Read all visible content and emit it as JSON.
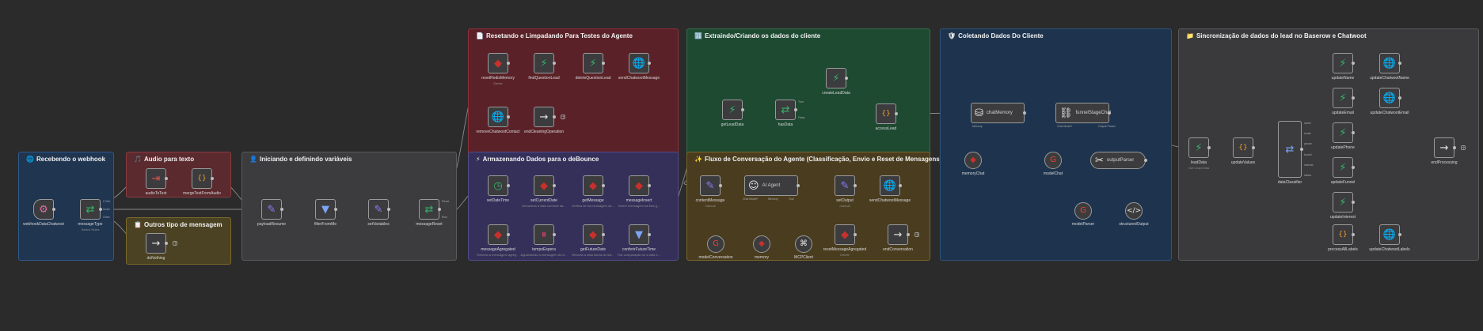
{
  "colors": {
    "canvas": "#2b2b2c",
    "wire": "#8a8a8a",
    "node_bg": "#3c3c3e",
    "node_border": "#9a9a9a",
    "green_icon": "#35b56a",
    "red_icon": "#c9302c",
    "blue_icon": "#7da4f5",
    "purple_icon": "#8b7cf6",
    "orange_icon": "#f0a030"
  },
  "groups": [
    {
      "id": "webhook",
      "title": "Recebendo o webhook",
      "icon": "globe-icon",
      "glyph": "🌐",
      "bg": "#1f3550",
      "border": "#2f5a8c"
    },
    {
      "id": "audio",
      "title": "Audio para texto",
      "icon": "music-icon",
      "glyph": "🎵",
      "bg": "#5a2a2e",
      "border": "#8c3b3f"
    },
    {
      "id": "outros",
      "title": "Outros tipo de mensagem",
      "icon": "clipboard-icon",
      "glyph": "📋",
      "bg": "#4a4222",
      "border": "#7a6a2b"
    },
    {
      "id": "iniciando",
      "title": "Iniciando e definindo variáveis",
      "icon": "person-icon",
      "glyph": "👤",
      "bg": "#3c3c3e",
      "border": "#5a5a5c"
    },
    {
      "id": "resetando",
      "title": "Resetando e Limpadando Para Testes do Agente",
      "icon": "document-icon",
      "glyph": "📄",
      "bg": "#5a2228",
      "border": "#8c2f38"
    },
    {
      "id": "armazenando",
      "title": "Armazenando Dados para o deBounce",
      "icon": "bolt-icon",
      "glyph": "⚡",
      "bg": "#34305a",
      "border": "#524a8a"
    },
    {
      "id": "extraindo",
      "title": "Extraindo/Criando os dados do cliente",
      "icon": "grid-icon",
      "glyph": "🔢",
      "bg": "#1e4a32",
      "border": "#2f6e4a"
    },
    {
      "id": "fluxo",
      "title": "Fluxo de Conversação do Agente (Classificação, Envio e Reset de Mensagens)",
      "icon": "sparkle-icon",
      "glyph": "✨",
      "bg": "#4a3d1f",
      "border": "#7a652b"
    },
    {
      "id": "coletando",
      "title": "Coletando Dados Do Cliente",
      "icon": "shield-icon",
      "glyph": "🛡",
      "bg": "#1e344e",
      "border": "#2e527a"
    },
    {
      "id": "sincronizacao",
      "title": "Sincronização de dados do lead no Baserow e Chatwoot",
      "icon": "folder-icon",
      "glyph": "📁",
      "bg": "#3a3a3c",
      "border": "#5a5a5c"
    }
  ],
  "nodes": [
    {
      "id": "webhook",
      "label": "webhookDataChatwoot",
      "sub": "",
      "icon": "webhook-icon",
      "glyph": "⚙",
      "color": "#e36aa0"
    },
    {
      "id": "messageType",
      "label": "messageType",
      "sub": "Switch Rules",
      "icon": "switch-icon",
      "glyph": "⇄",
      "color": "#35b56a"
    },
    {
      "id": "audioToText",
      "label": "audioToText",
      "sub": "",
      "icon": "sign-in-icon",
      "glyph": "⇥",
      "color": "#e0504a"
    },
    {
      "id": "mergeTextFromAudio",
      "label": "mergeTextFromAudio",
      "sub": "",
      "icon": "braces-icon",
      "glyph": "{}",
      "color": "#f0a030"
    },
    {
      "id": "doNothing",
      "label": "doNothing",
      "sub": "",
      "icon": "arrow-right-icon",
      "glyph": "→",
      "color": "#e8e8e8"
    },
    {
      "id": "payloadResume",
      "label": "payloadResume",
      "sub": "",
      "icon": "pencil-icon",
      "glyph": "✎",
      "color": "#8b7cf6"
    },
    {
      "id": "filterFromMe",
      "label": "filterFromMe",
      "sub": "",
      "icon": "filter-icon",
      "glyph": "▼",
      "color": "#7da4f5"
    },
    {
      "id": "setVariables",
      "label": "setVariables",
      "sub": "",
      "icon": "pencil-icon",
      "glyph": "✎",
      "color": "#8b7cf6"
    },
    {
      "id": "messageReset",
      "label": "messageReset",
      "sub": "",
      "icon": "switch-icon",
      "glyph": "⇄",
      "color": "#35b56a"
    },
    {
      "id": "resetRedisMemory",
      "label": "resetRedisMemory",
      "sub": "Delete",
      "icon": "redis-icon",
      "glyph": "◆",
      "color": "#c9302c"
    },
    {
      "id": "findQuestionLead",
      "label": "findQuestionLead",
      "sub": "",
      "icon": "baserow-icon",
      "glyph": "⚡",
      "color": "#35b56a"
    },
    {
      "id": "deleteQuestionLead",
      "label": "deleteQuestionLead",
      "sub": "",
      "icon": "baserow-icon",
      "glyph": "⚡",
      "color": "#35b56a"
    },
    {
      "id": "sendChatwootMessage",
      "label": "sendChatwootMessage",
      "sub": "",
      "icon": "globe-icon",
      "glyph": "🌐",
      "color": "#7da4f5"
    },
    {
      "id": "removeChatwootContact",
      "label": "removeChatwootContact",
      "sub": "",
      "icon": "globe-icon",
      "glyph": "🌐",
      "color": "#7da4f5"
    },
    {
      "id": "endCleaningOperation",
      "label": "endCleaningOperation",
      "sub": "",
      "icon": "arrow-right-icon",
      "glyph": "→",
      "color": "#e8e8e8"
    },
    {
      "id": "setDateTime",
      "label": "setDateTime",
      "sub": "",
      "icon": "clock-icon",
      "glyph": "◷",
      "color": "#35b56a"
    },
    {
      "id": "setCurrentDate",
      "label": "setCurrentDate",
      "sub": "Armazena a data corrente da...",
      "icon": "redis-icon",
      "glyph": "◆",
      "color": "#c9302c"
    },
    {
      "id": "getMessage",
      "label": "getMessage",
      "sub": "Verifica se há mensagem de...",
      "icon": "redis-icon",
      "glyph": "◆",
      "color": "#c9302c"
    },
    {
      "id": "messageInsert",
      "label": "messageInsert",
      "sub": "Insere mensagem na lista (j...",
      "icon": "redis-icon",
      "glyph": "◆",
      "color": "#c9302c"
    },
    {
      "id": "messageAgregated",
      "label": "messageAgregated",
      "sub": "Retorna a mensagem agreg...",
      "icon": "redis-icon",
      "glyph": "◆",
      "color": "#c9302c"
    },
    {
      "id": "tempoEspera",
      "label": "tempoEspera",
      "sub": "Aguardando a mensagem do cl...",
      "icon": "pause-icon",
      "glyph": "⏸",
      "color": "#d04070"
    },
    {
      "id": "getFutureDate",
      "label": "getFutureDate",
      "sub": "Retorna a data futura do lea...",
      "icon": "redis-icon",
      "glyph": "◆",
      "color": "#c9302c"
    },
    {
      "id": "conferirFutureTime",
      "label": "conferirFutureTime",
      "sub": "Faz comparação se a data e...",
      "icon": "filter-icon",
      "glyph": "▼",
      "color": "#7da4f5"
    },
    {
      "id": "getLeadData",
      "label": "getLeadData",
      "sub": "",
      "icon": "baserow-icon",
      "glyph": "⚡",
      "color": "#35b56a"
    },
    {
      "id": "hasData",
      "label": "hasData",
      "sub": "",
      "icon": "switch-icon",
      "glyph": "⇄",
      "color": "#35b56a"
    },
    {
      "id": "createLeadData",
      "label": "createLeadData",
      "sub": "",
      "icon": "baserow-icon",
      "glyph": "⚡",
      "color": "#35b56a"
    },
    {
      "id": "accessLead",
      "label": "accessLead",
      "sub": "",
      "icon": "braces-icon",
      "glyph": "{}",
      "color": "#f0a030"
    },
    {
      "id": "contentMessage",
      "label": "contentMessage",
      "sub": "manual",
      "icon": "pencil-icon",
      "glyph": "✎",
      "color": "#8b7cf6"
    },
    {
      "id": "aiAgent",
      "label": "AI Agent",
      "sub": "",
      "icon": "robot-icon",
      "glyph": "☺",
      "color": "#e8e8e8"
    },
    {
      "id": "setOutput",
      "label": "setOutput",
      "sub": "manual",
      "icon": "pencil-icon",
      "glyph": "✎",
      "color": "#8b7cf6"
    },
    {
      "id": "sendChatwootMessage2",
      "label": "sendChatwootMessage",
      "sub": "",
      "icon": "globe-icon",
      "glyph": "🌐",
      "color": "#7da4f5"
    },
    {
      "id": "resetMessageAgregated",
      "label": "resetMessageAgregated",
      "sub": "Delete",
      "icon": "redis-icon",
      "glyph": "◆",
      "color": "#c9302c"
    },
    {
      "id": "endConversation",
      "label": "endConversation",
      "sub": "",
      "icon": "arrow-right-icon",
      "glyph": "→",
      "color": "#e8e8e8"
    },
    {
      "id": "modelConversation",
      "label": "modelConversation",
      "sub": "",
      "icon": "google-icon",
      "glyph": "G",
      "color": "#ea4335"
    },
    {
      "id": "memory",
      "label": "memory",
      "sub": "",
      "icon": "redis-icon",
      "glyph": "◆",
      "color": "#c9302c"
    },
    {
      "id": "mcpClient",
      "label": "MCPClient",
      "sub": "",
      "icon": "mcp-icon",
      "glyph": "⌘",
      "color": "#e8e8e8"
    },
    {
      "id": "chatMemory",
      "label": "chatMemory",
      "sub": "",
      "icon": "database-icon",
      "glyph": "⛁",
      "color": "#e8e8e8"
    },
    {
      "id": "funnelStageChat",
      "label": "funnelStageChat",
      "sub": "",
      "icon": "link-icon",
      "glyph": "⛓",
      "color": "#e8e8e8"
    },
    {
      "id": "memoryChat",
      "label": "memoryChat",
      "sub": "",
      "icon": "redis-icon",
      "glyph": "◆",
      "color": "#c9302c"
    },
    {
      "id": "modelChat",
      "label": "modelChat",
      "sub": "",
      "icon": "google-icon",
      "glyph": "G",
      "color": "#ea4335"
    },
    {
      "id": "outputParser",
      "label": "outputParser",
      "sub": "",
      "icon": "tools-icon",
      "glyph": "✂",
      "color": "#e8e8e8"
    },
    {
      "id": "modelParser",
      "label": "modelParser",
      "sub": "",
      "icon": "google-icon",
      "glyph": "G",
      "color": "#ea4335"
    },
    {
      "id": "structuredOutput",
      "label": "structuredOutput",
      "sub": "",
      "icon": "code-icon",
      "glyph": "</>",
      "color": "#e8e8e8"
    },
    {
      "id": "leadData",
      "label": "leadData",
      "sub": "Get Lead Data",
      "icon": "baserow-icon",
      "glyph": "⚡",
      "color": "#35b56a"
    },
    {
      "id": "updateValues",
      "label": "updateValues",
      "sub": "",
      "icon": "braces-icon",
      "glyph": "{}",
      "color": "#f0a030"
    },
    {
      "id": "dataClassifier",
      "label": "dataClassifier",
      "sub": "",
      "icon": "switch-icon",
      "glyph": "⇄",
      "color": "#7da4f5"
    },
    {
      "id": "updateName",
      "label": "updateName",
      "sub": "",
      "icon": "baserow-icon",
      "glyph": "⚡",
      "color": "#35b56a"
    },
    {
      "id": "updateChatwootName",
      "label": "updateChatwootName",
      "sub": "",
      "icon": "globe-icon",
      "glyph": "🌐",
      "color": "#7da4f5"
    },
    {
      "id": "updateEmail",
      "label": "updateEmail",
      "sub": "",
      "icon": "baserow-icon",
      "glyph": "⚡",
      "color": "#35b56a"
    },
    {
      "id": "updateChatwootEmail",
      "label": "updateChatwootEmail",
      "sub": "",
      "icon": "globe-icon",
      "glyph": "🌐",
      "color": "#7da4f5"
    },
    {
      "id": "updatePhone",
      "label": "updatePhone",
      "sub": "",
      "icon": "baserow-icon",
      "glyph": "⚡",
      "color": "#35b56a"
    },
    {
      "id": "updateFunnel",
      "label": "updateFunnel",
      "sub": "",
      "icon": "baserow-icon",
      "glyph": "⚡",
      "color": "#35b56a"
    },
    {
      "id": "updateInterest",
      "label": "updateInterest",
      "sub": "",
      "icon": "baserow-icon",
      "glyph": "⚡",
      "color": "#35b56a"
    },
    {
      "id": "processAllLabels",
      "label": "processAllLabels",
      "sub": "",
      "icon": "braces-icon",
      "glyph": "{}",
      "color": "#f0a030"
    },
    {
      "id": "updateChatwootLabels",
      "label": "updateChatwootLabels",
      "sub": "",
      "icon": "globe-icon",
      "glyph": "🌐",
      "color": "#7da4f5"
    },
    {
      "id": "endProcessing",
      "label": "endProcessing",
      "sub": "",
      "icon": "arrow-right-icon",
      "glyph": "→",
      "color": "#e8e8e8"
    }
  ],
  "port_labels": {
    "messageType": [
      "0 Text",
      "Audio",
      "Other"
    ],
    "messageReset": [
      "Reset",
      "Else"
    ],
    "hasData": [
      "True",
      "False"
    ],
    "dataClassifier": [
      "name",
      "email",
      "phone",
      "funnel",
      "interest",
      "labels"
    ],
    "sub_labels": {
      "chatModel": "Chat Model*",
      "memory": "Memory",
      "tool": "Tool",
      "outputParser": "Output Parser"
    }
  }
}
